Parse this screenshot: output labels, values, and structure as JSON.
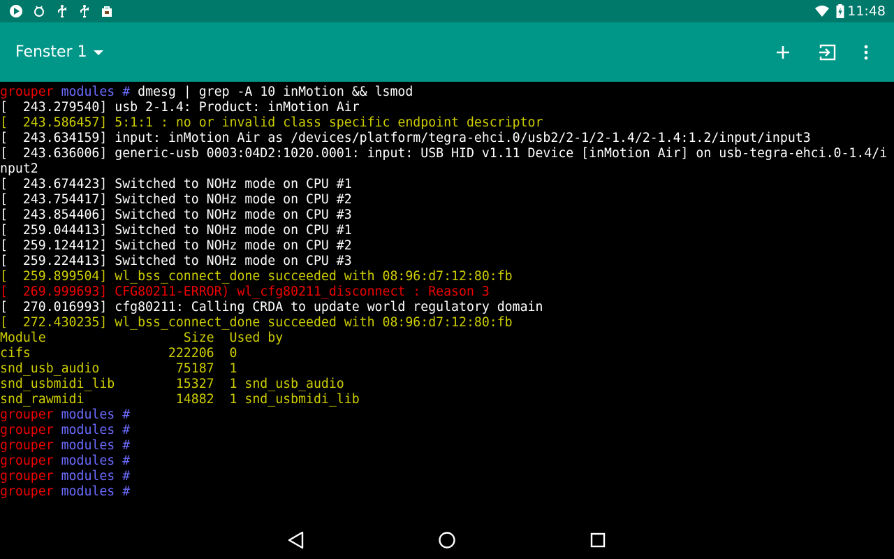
{
  "status_bar": {
    "time": "11:48",
    "icons": [
      "play-store-icon",
      "android-debug-icon",
      "usb-icon",
      "usb-icon",
      "shop-bag-icon",
      "wifi-icon",
      "battery-charging-icon"
    ]
  },
  "app_bar": {
    "title": "Fenster 1",
    "actions": [
      "add-icon",
      "exit-icon",
      "more-vert-icon"
    ]
  },
  "colors": {
    "status_bar": "#00796b",
    "app_bar": "#009688",
    "terminal_bg": "#000000",
    "text_white": "#ffffff",
    "text_yellow": "#cdcd00",
    "text_red": "#ee0000",
    "prompt_dir": "#6b6bff"
  },
  "prompt": {
    "host": "grouper",
    "dir": "modules",
    "symbol": "#"
  },
  "terminal": {
    "command": "dmesg | grep -A 10 inMotion && lsmod",
    "dmesg": [
      {
        "text": "[  243.279540] usb 2-1.4: Product: inMotion Air",
        "color": "w"
      },
      {
        "text": "[  243.586457] 5:1:1 : no or invalid class specific endpoint descriptor",
        "color": "y"
      },
      {
        "text": "[  243.634159] input: inMotion Air as /devices/platform/tegra-ehci.0/usb2/2-1/2-1.4/2-1.4:1.2/input/input3",
        "color": "w"
      },
      {
        "text": "[  243.636006] generic-usb 0003:04D2:1020.0001: input: USB HID v1.11 Device [inMotion Air] on usb-tegra-ehci.0-1.4/i",
        "color": "w"
      },
      {
        "text": "nput2",
        "color": "w"
      },
      {
        "text": "[  243.674423] Switched to NOHz mode on CPU #1",
        "color": "w"
      },
      {
        "text": "[  243.754417] Switched to NOHz mode on CPU #2",
        "color": "w"
      },
      {
        "text": "[  243.854406] Switched to NOHz mode on CPU #3",
        "color": "w"
      },
      {
        "text": "[  259.044413] Switched to NOHz mode on CPU #1",
        "color": "w"
      },
      {
        "text": "[  259.124412] Switched to NOHz mode on CPU #2",
        "color": "w"
      },
      {
        "text": "[  259.224413] Switched to NOHz mode on CPU #3",
        "color": "w"
      },
      {
        "text": "[  259.899504] wl_bss_connect_done succeeded with 08:96:d7:12:80:fb",
        "color": "y"
      },
      {
        "text": "[  269.999693] CFG80211-ERROR) wl_cfg80211_disconnect : Reason 3",
        "color": "r"
      },
      {
        "text": "[  270.016993] cfg80211: Calling CRDA to update world regulatory domain",
        "color": "w"
      },
      {
        "text": "[  272.430235] wl_bss_connect_done succeeded with 08:96:d7:12:80:fb",
        "color": "y"
      }
    ],
    "lsmod": [
      "Module                  Size  Used by",
      "cifs                  222206  0",
      "snd_usb_audio          75187  1",
      "snd_usbmidi_lib        15327  1 snd_usb_audio",
      "snd_rawmidi            14882  1 snd_usbmidi_lib"
    ],
    "empty_prompts": 6
  },
  "nav_bar": {
    "buttons": [
      "back-icon",
      "home-icon",
      "recents-icon"
    ]
  }
}
